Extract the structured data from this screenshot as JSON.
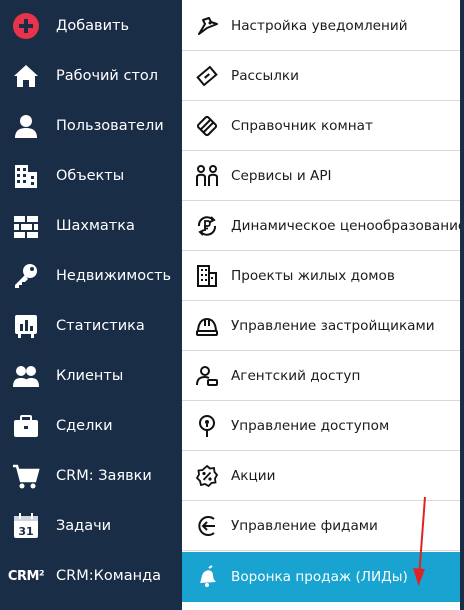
{
  "sidebar": {
    "items": [
      {
        "label": "Добавить",
        "icon": "plus-circle-icon"
      },
      {
        "label": "Рабочий стол",
        "icon": "home-icon"
      },
      {
        "label": "Пользователи",
        "icon": "user-icon"
      },
      {
        "label": "Объекты",
        "icon": "buildings-icon"
      },
      {
        "label": "Шахматка",
        "icon": "bricks-icon"
      },
      {
        "label": "Недвижимость",
        "icon": "key-icon"
      },
      {
        "label": "Статистика",
        "icon": "bar-chart-icon"
      },
      {
        "label": "Клиенты",
        "icon": "users-icon"
      },
      {
        "label": "Сделки",
        "icon": "briefcase-icon"
      },
      {
        "label": "CRM: Заявки",
        "icon": "cart-icon"
      },
      {
        "label": "Задачи",
        "icon": "calendar-icon",
        "icon_text": "31"
      },
      {
        "label": "CRM:Команда",
        "icon": "crm2-logo",
        "icon_text": "CRM²"
      }
    ]
  },
  "submenu": {
    "items": [
      {
        "label": "Настройка уведомлений",
        "icon": "bell-settings-icon"
      },
      {
        "label": "Рассылки",
        "icon": "send-icon"
      },
      {
        "label": "Справочник комнат",
        "icon": "book-icon"
      },
      {
        "label": "Сервисы и API",
        "icon": "people-api-icon"
      },
      {
        "label": "Динамическое ценообразование",
        "icon": "ruble-cycle-icon"
      },
      {
        "label": "Проекты жилых домов",
        "icon": "apartment-icon"
      },
      {
        "label": "Управление застройщиками",
        "icon": "hardhat-icon"
      },
      {
        "label": "Агентский доступ",
        "icon": "agent-icon"
      },
      {
        "label": "Управление доступом",
        "icon": "location-key-icon"
      },
      {
        "label": "Акции",
        "icon": "percent-badge-icon"
      },
      {
        "label": "Управление фидами",
        "icon": "feed-arrow-icon"
      },
      {
        "label": "Воронка продаж (ЛИДы)",
        "icon": "bell-funnel-icon",
        "active": true
      }
    ]
  },
  "colors": {
    "sidebar_bg": "#1a2d47",
    "plus_red": "#e8334a",
    "active_bg": "#18a3d0",
    "annotation_arrow": "#e02424"
  }
}
